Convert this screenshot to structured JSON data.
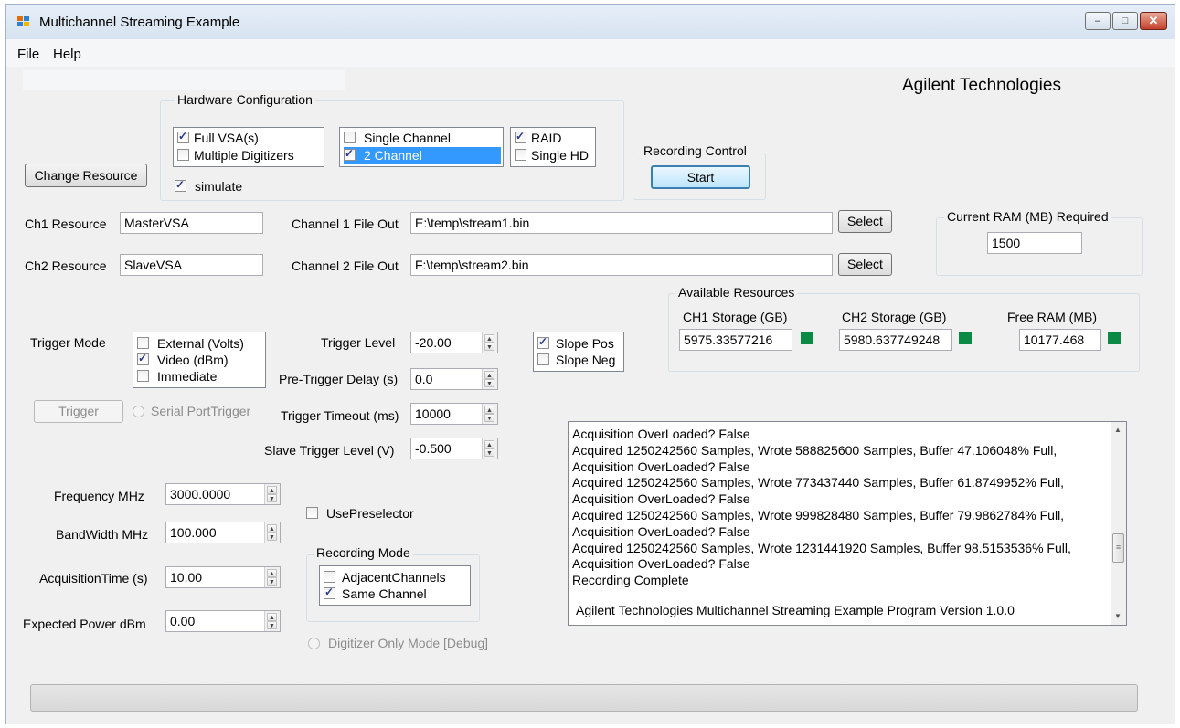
{
  "window": {
    "title": "Multichannel Streaming Example",
    "minimize_glyph": "–",
    "maximize_glyph": "□",
    "close_glyph": "✕"
  },
  "menu": {
    "file": "File",
    "help": "Help"
  },
  "brand": "Agilent Technologies",
  "hardware_config": {
    "title": "Hardware Configuration",
    "full_vsa": "Full VSA(s)",
    "multiple_digitizers": "Multiple Digitizers",
    "single_channel": "Single Channel",
    "two_channel": "2 Channel",
    "raid": "RAID",
    "single_hd": "Single HD",
    "simulate": "simulate"
  },
  "change_resource_label": "Change Resource",
  "recording_control": {
    "title": "Recording Control",
    "start_label": "Start"
  },
  "resources": {
    "ch1_label": "Ch1 Resource",
    "ch1_value": "MasterVSA",
    "ch2_label": "Ch2 Resource",
    "ch2_value": "SlaveVSA",
    "ch1_file_label": "Channel 1 File Out",
    "ch1_file_value": "E:\\temp\\stream1.bin",
    "ch2_file_label": "Channel 2 File Out",
    "ch2_file_value": "F:\\temp\\stream2.bin",
    "select_label": "Select"
  },
  "ram_required": {
    "title": "Current RAM (MB) Required",
    "value": "1500"
  },
  "available": {
    "title": "Available Resources",
    "ch1_label": "CH1 Storage (GB)",
    "ch1_value": "5975.33577216",
    "ch2_label": "CH2 Storage (GB)",
    "ch2_value": "5980.637749248",
    "ram_label": "Free RAM (MB)",
    "ram_value": "10177.468",
    "indicator_color": "#0a8a45"
  },
  "trigger": {
    "mode_label": "Trigger Mode",
    "external": "External (Volts)",
    "video": "Video (dBm)",
    "immediate": "Immediate",
    "level_label": "Trigger Level",
    "level_value": "-20.00",
    "pre_delay_label": "Pre-Trigger Delay (s)",
    "pre_delay_value": "0.0",
    "timeout_label": "Trigger Timeout (ms)",
    "timeout_value": "10000",
    "slave_level_label": "Slave Trigger Level (V)",
    "slave_level_value": "-0.500",
    "slope_pos": "Slope Pos",
    "slope_neg": "Slope Neg",
    "trigger_button": "Trigger",
    "serial_port": "Serial PortTrigger"
  },
  "params": {
    "freq_label": "Frequency MHz",
    "freq_value": "3000.0000",
    "bw_label": "BandWidth MHz",
    "bw_value": "100.000",
    "acq_label": "AcquisitionTime (s)",
    "acq_value": "10.00",
    "power_label": "Expected Power dBm",
    "power_value": "0.00",
    "use_preselector": "UsePreselector"
  },
  "recording_mode": {
    "title": "Recording Mode",
    "adjacent": "AdjacentChannels",
    "same": "Same Channel"
  },
  "digitizer_only": "Digitizer Only Mode [Debug]",
  "log": [
    "Acquisition OverLoaded? False",
    "Acquired 1250242560 Samples, Wrote 588825600 Samples, Buffer 47.106048% Full,",
    "Acquisition OverLoaded? False",
    "Acquired 1250242560 Samples, Wrote 773437440 Samples, Buffer 61.8749952% Full,",
    "Acquisition OverLoaded? False",
    "Acquired 1250242560 Samples, Wrote 999828480 Samples, Buffer 79.9862784% Full,",
    "Acquisition OverLoaded? False",
    "Acquired 1250242560 Samples, Wrote 1231441920 Samples, Buffer 98.5153536% Full,",
    "Acquisition OverLoaded? False",
    "Recording Complete"
  ],
  "log_footer": "Agilent Technologies Multichannel Streaming Example Program Version 1.0.0",
  "progress_fraction": 0
}
